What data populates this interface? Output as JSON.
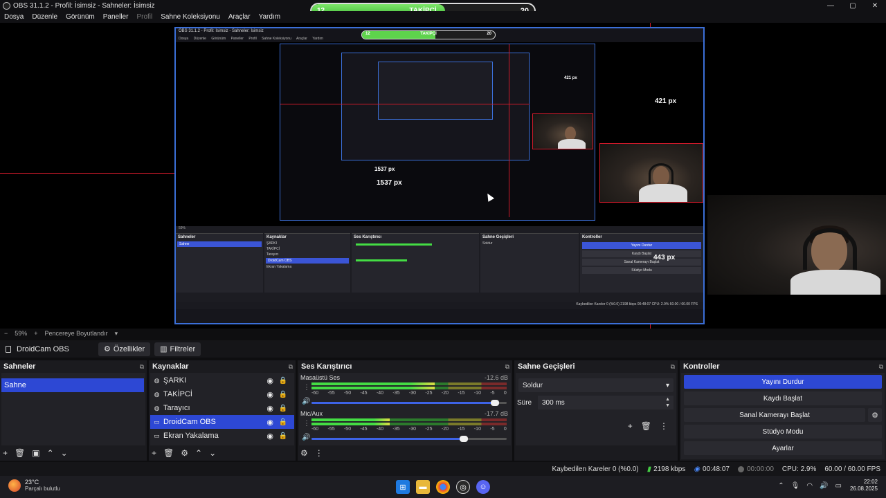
{
  "window": {
    "title": "OBS 31.1.2 - Profil: İsimsiz - Sahneler: İsimsiz",
    "controls": {
      "minimize": "—",
      "maximize": "▢",
      "close": "✕"
    }
  },
  "menu": [
    "Dosya",
    "Düzenle",
    "Görünüm",
    "Paneller",
    "Profil",
    "Sahne Koleksiyonu",
    "Araçlar",
    "Yardım"
  ],
  "follower_widget": {
    "label": "TAKİPÇİ",
    "current": "12",
    "goal": "20",
    "progress": 0.6,
    "colors": {
      "fill": "#5ed34c",
      "bg": "#1e1e1e"
    }
  },
  "preview": {
    "measure_labels": {
      "top_right": "421 px",
      "middle": "1537 px",
      "bottom_right": "443 px"
    },
    "nested": {
      "title": "OBS 31.1.2 - Profil: İsimsiz - Sahneler: İsimsiz",
      "menu": [
        "Dosya",
        "Düzenle",
        "Görünüm",
        "Paneller",
        "Profil",
        "Sahne Koleksiyonu",
        "Araçlar",
        "Yardım"
      ],
      "zoom": "59%",
      "fit_label": "Pencereye Boyutlandır",
      "source_name": "DroidCam OBS",
      "props": "Özellikler",
      "filters": "Filtreler",
      "docks": [
        "Sahneler",
        "Kaynaklar",
        "Ses Karıştırıcı",
        "Sahne Geçişleri",
        "Kontroller"
      ],
      "scene": "Sahne",
      "sources": [
        "ŞARKI",
        "TAKİPCİ",
        "Tarayıcı",
        "DroidCam OBS",
        "Ekran Yakalama"
      ],
      "controls": [
        "Yayını Durdur",
        "Kaydı Başlat",
        "Sanal Kamerayı Başlat",
        "Stüdyo Modu",
        "Ayarlar"
      ],
      "status": "Kaybedilen Kareler 0 (%0.0)   2198 kbps   00:48:07   CPU: 2.9%   60.00 / 60.00 FPS"
    }
  },
  "zoom_row": {
    "zoom": "59%",
    "plus": "+",
    "fit_label": "Pencereye Boyutlandır"
  },
  "source_bar": {
    "name": "DroidCam OBS",
    "properties": "Özellikler",
    "filters": "Filtreler"
  },
  "docks": {
    "scenes": {
      "title": "Sahneler",
      "items": [
        "Sahne"
      ]
    },
    "sources": {
      "title": "Kaynaklar",
      "items": [
        {
          "name": "ŞARKI",
          "icon": "browser-icon",
          "selected": false
        },
        {
          "name": "TAKİPCİ",
          "icon": "browser-icon",
          "selected": false
        },
        {
          "name": "Tarayıcı",
          "icon": "browser-icon",
          "selected": false
        },
        {
          "name": "DroidCam OBS",
          "icon": "media-icon",
          "selected": true
        },
        {
          "name": "Ekran Yakalama",
          "icon": "monitor-icon",
          "selected": false
        }
      ]
    },
    "mixer": {
      "title": "Ses Karıştırıcı",
      "ticks": [
        "-60",
        "-55",
        "-50",
        "-45",
        "-40",
        "-35",
        "-30",
        "-25",
        "-20",
        "-15",
        "-10",
        "-5",
        "0"
      ],
      "channels": [
        {
          "name": "Masaüstü Ses",
          "db": "-12.6 dB",
          "level": 0.63,
          "volume": 0.94
        },
        {
          "name": "Mic/Aux",
          "db": "-17.7 dB",
          "level": 0.4,
          "volume": 0.78
        }
      ]
    },
    "transitions": {
      "title": "Sahne Geçişleri",
      "selected": "Soldur",
      "duration_label": "Süre",
      "duration": "300 ms"
    },
    "controls": {
      "title": "Kontroller",
      "stream": "Yayını Durdur",
      "record": "Kaydı Başlat",
      "virtualcam": "Sanal Kamerayı Başlat",
      "studio": "Stüdyo Modu",
      "settings": "Ayarlar"
    }
  },
  "statusbar": {
    "dropped": "Kaybedilen Kareler 0 (%0.0)",
    "bitrate": "2198 kbps",
    "stream_time": "00:48:07",
    "record_time": "00:00:00",
    "cpu": "CPU: 2.9%",
    "fps": "60.00 / 60.00 FPS"
  },
  "taskbar": {
    "weather_temp": "23°C",
    "weather_cond": "Parçalı bulutlu",
    "time": "22:02",
    "date": "26.08.2025",
    "apps": [
      "windows-start-icon",
      "file-explorer-icon",
      "chrome-icon",
      "obs-icon",
      "discord-icon"
    ]
  },
  "colors": {
    "accent": "#2d48d4",
    "selection_red": "#d11a2a",
    "meter_green": "#44dd44"
  }
}
